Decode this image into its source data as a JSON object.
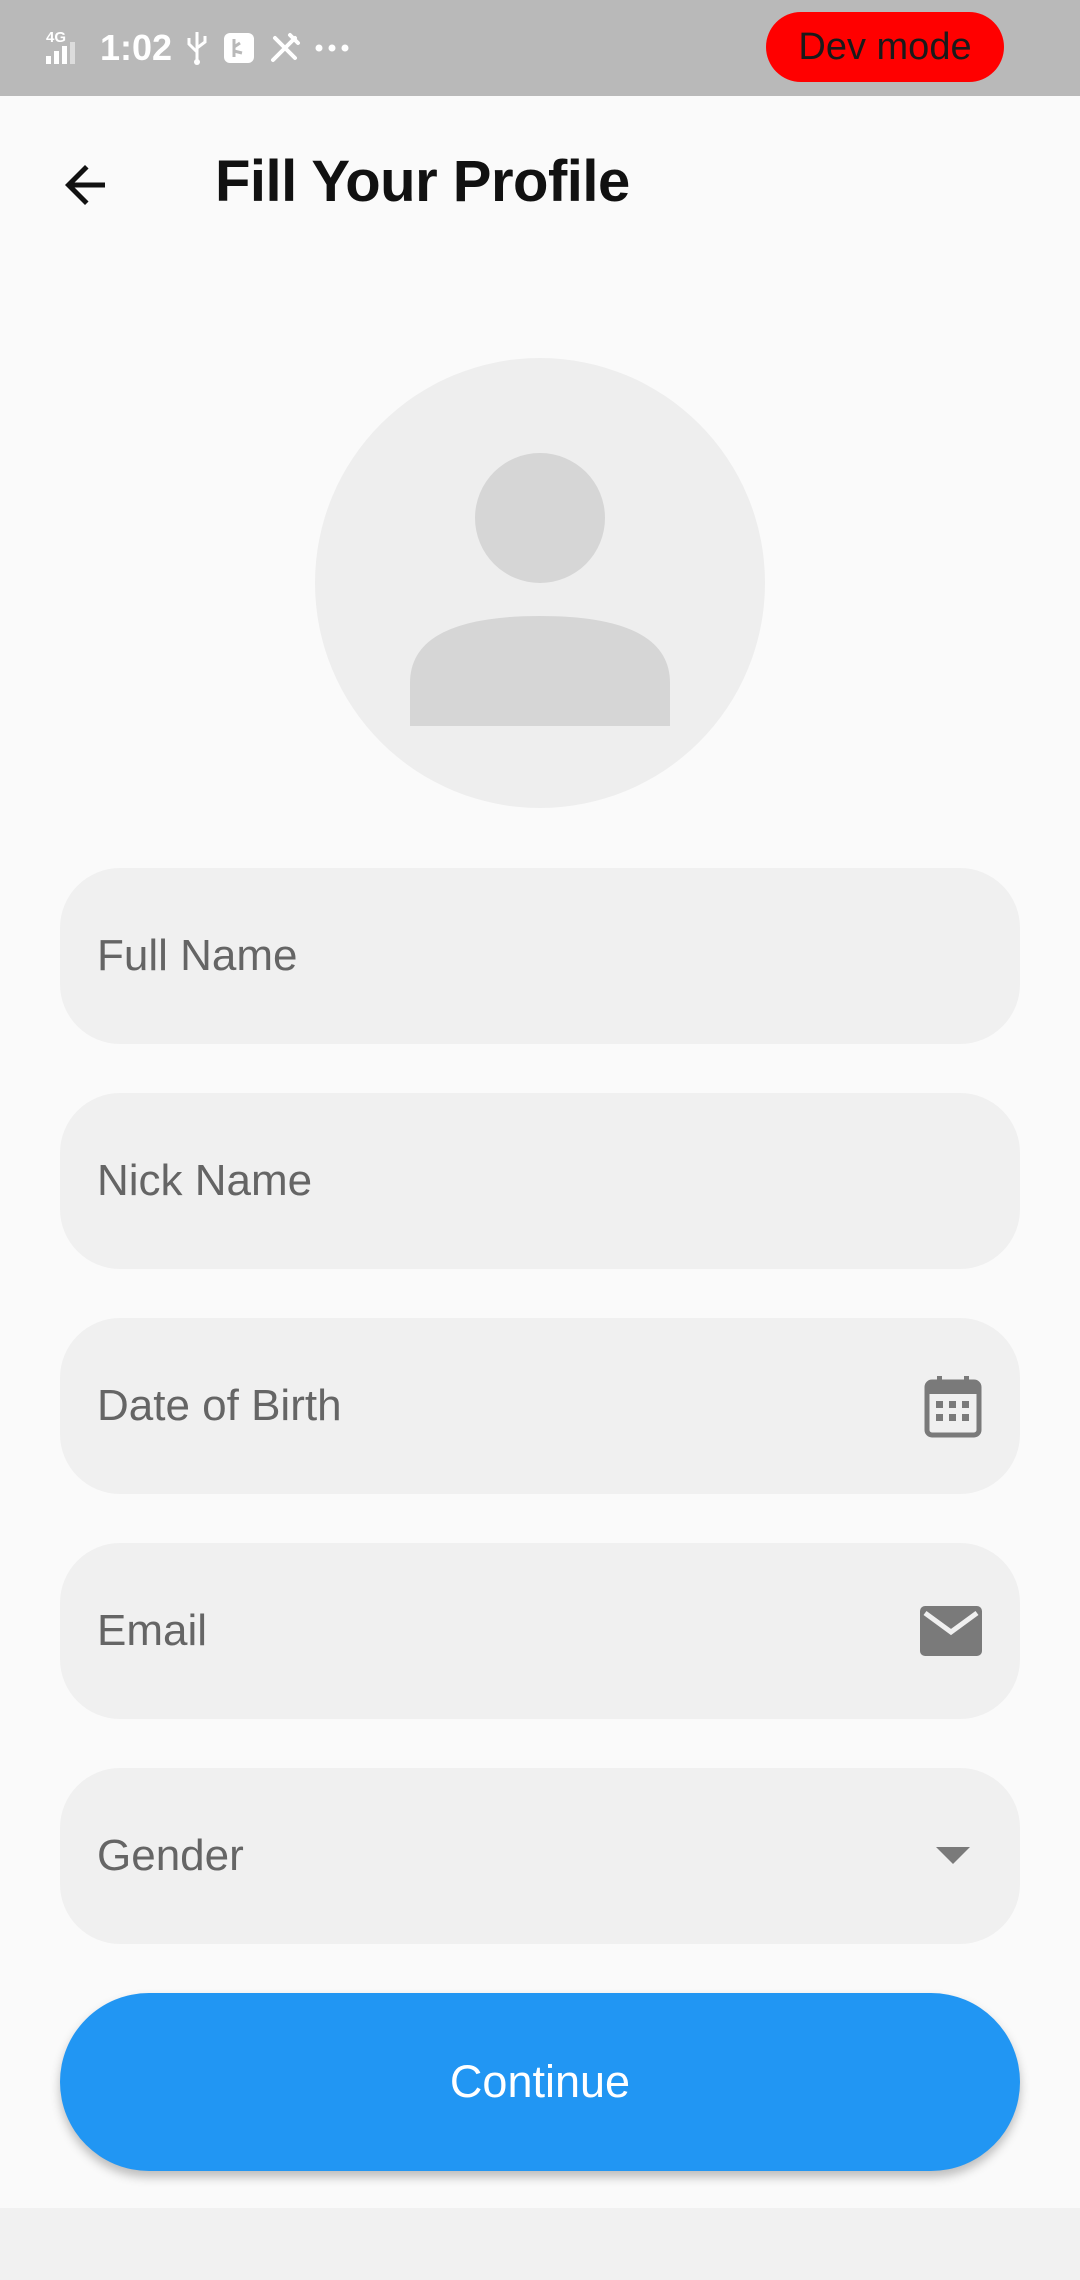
{
  "status_bar": {
    "network": "4G",
    "time": "1:02",
    "dev_mode_label": "Dev mode"
  },
  "app_bar": {
    "back_icon": "arrow-left-icon",
    "title": "Fill Your Profile"
  },
  "avatar": {
    "icon": "person-placeholder-icon"
  },
  "form": {
    "full_name_placeholder": "Full Name",
    "nick_name_placeholder": "Nick Name",
    "dob_placeholder": "Date of Birth",
    "dob_icon": "calendar-icon",
    "email_placeholder": "Email",
    "email_icon": "mail-icon",
    "gender_placeholder": "Gender",
    "gender_icon": "dropdown-arrow-icon"
  },
  "continue_label": "Continue",
  "colors": {
    "primary": "#2196f3",
    "dev_mode": "#ff0000",
    "status_bar": "#b9b9b9"
  }
}
